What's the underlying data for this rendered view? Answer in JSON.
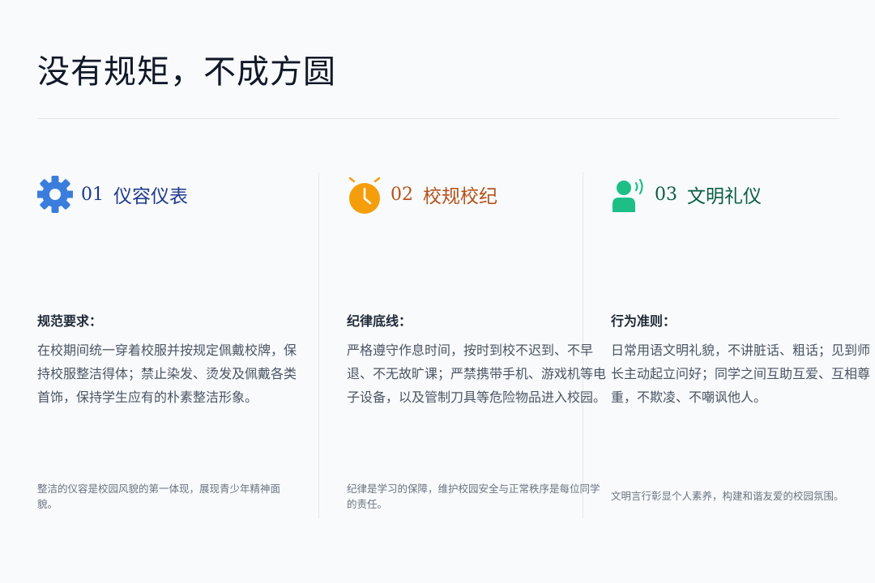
{
  "page": {
    "title": "没有规矩，不成方圆"
  },
  "colors": {
    "gear_icon": "#3b7ddd",
    "alarm_icon": "#f59e0b",
    "person_icon": "#1dbf87",
    "heading_blue": "#1e3a8a",
    "heading_orange": "#b4531a",
    "heading_green": "#0b5e45"
  },
  "columns": [
    {
      "icon": "gear-icon",
      "number": "01",
      "heading": "仪容仪表",
      "label": "规范要求：",
      "body": "在校期间统一穿着校服并按规定佩戴校牌，保持校服整洁得体；禁止染发、烫发及佩戴各类首饰，保持学生应有的朴素整洁形象。",
      "footer": "整洁的仪容是校园风貌的第一体现，展现青少年精神面貌。"
    },
    {
      "icon": "alarm-clock-icon",
      "number": "02",
      "heading": "校规校纪",
      "label": "纪律底线：",
      "body": "严格遵守作息时间，按时到校不迟到、不早退、不无故旷课；严禁携带手机、游戏机等电子设备，以及管制刀具等危险物品进入校园。",
      "footer": "纪律是学习的保障，维护校园安全与正常秩序是每位同学的责任。"
    },
    {
      "icon": "person-speaking-icon",
      "number": "03",
      "heading": "文明礼仪",
      "label": "行为准则：",
      "body": "日常用语文明礼貌，不讲脏话、粗话；见到师长主动起立问好；同学之间互助互爱、互相尊重，不欺凌、不嘲讽他人。",
      "footer": "文明言行彰显个人素养，构建和谐友爱的校园氛围。"
    }
  ]
}
